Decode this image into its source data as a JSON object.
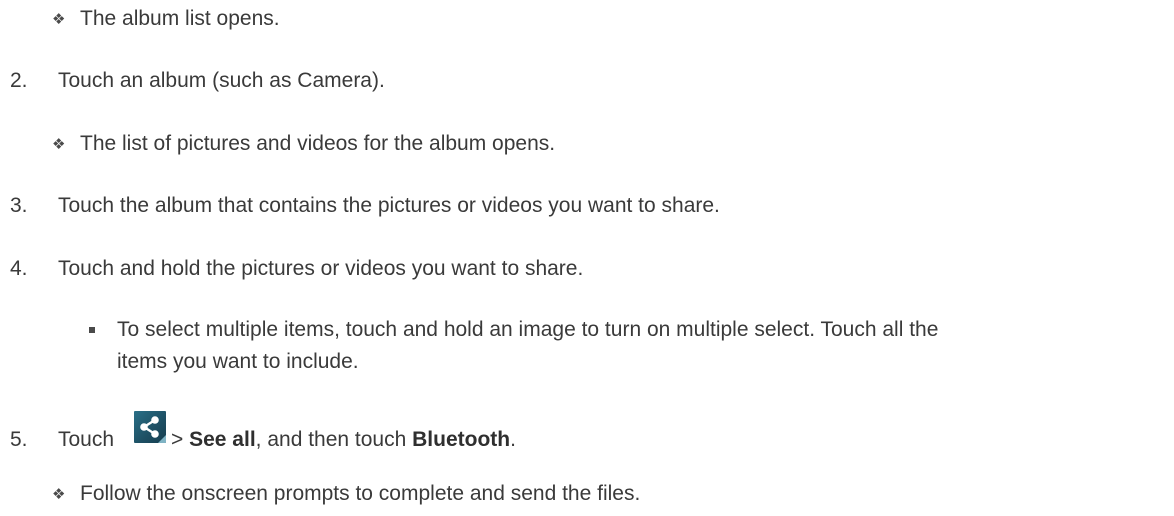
{
  "content": {
    "result_1": "The album list opens.",
    "step_2": {
      "num": "2.",
      "text": "Touch an album (such as Camera)."
    },
    "result_2": "The list of pictures and videos for the album opens.",
    "step_3": {
      "num": "3.",
      "text": "Touch the album that contains the pictures or videos you want to share."
    },
    "step_4": {
      "num": "4.",
      "text": "Touch and hold the pictures or videos you want to share."
    },
    "sub_bullet_4": {
      "line1": "To select multiple items, touch and hold an image to turn on multiple select. Touch all the",
      "line2": "items you want to include."
    },
    "step_5": {
      "num": "5.",
      "touch": "Touch",
      "sep": ">",
      "see_all": "See all",
      "then": ", and then touch",
      "bluetooth": "Bluetooth",
      "period": "."
    },
    "result_5": "Follow the onscreen prompts to complete and send the files.",
    "icons": {
      "result_bullet": "four-diamond-bullet-icon",
      "sub_bullet": "square-bullet-icon",
      "share": "share-icon"
    }
  }
}
